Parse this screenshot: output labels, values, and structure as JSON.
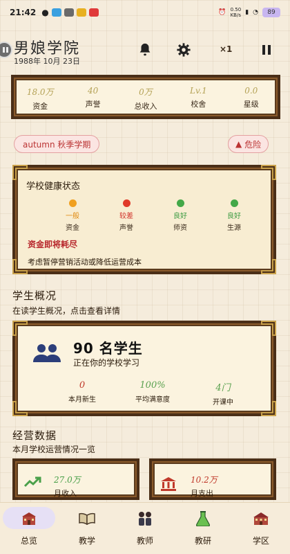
{
  "status_bar": {
    "time": "21:42",
    "net_speed": "0.50\nKB/s",
    "battery": "89"
  },
  "header": {
    "title": "男娘学院",
    "date": "1988年 10月 23日",
    "speed": "×1"
  },
  "stats": [
    {
      "value": "18.0万",
      "label": "资金"
    },
    {
      "value": "40",
      "label": "声誉"
    },
    {
      "value": "0万",
      "label": "总收入"
    },
    {
      "value": "Lv.1",
      "label": "校舍"
    },
    {
      "value": "0.0",
      "label": "星级"
    }
  ],
  "season_pill": "autumn 秋季学期",
  "danger_pill": "危险",
  "health": {
    "title": "学校健康状态",
    "indicators": [
      {
        "status": "一般",
        "name": "资金",
        "color": "#f0a020"
      },
      {
        "status": "较差",
        "name": "声誉",
        "color": "#e03a2a"
      },
      {
        "status": "良好",
        "name": "师资",
        "color": "#43a848"
      },
      {
        "status": "良好",
        "name": "生源",
        "color": "#43a848"
      }
    ],
    "warning": "资金即将耗尽",
    "advice": "考虑暂停营销活动或降低运营成本"
  },
  "students_section": {
    "title": "学生概况",
    "subtitle": "在读学生概况，点击查看详情",
    "count": "90 名学生",
    "count_sub": "正在你的学校学习",
    "stats": [
      {
        "value": "0",
        "label": "本月新生"
      },
      {
        "value": "100%",
        "label": "平均满意度"
      },
      {
        "value": "4门",
        "label": "开课中"
      }
    ]
  },
  "ops_section": {
    "title": "经营数据",
    "subtitle": "本月学校运营情况一览",
    "cards": [
      {
        "value": "27.0万",
        "label": "月收入",
        "color": "#4aa04a"
      },
      {
        "value": "10.2万",
        "label": "月支出",
        "color": "#c0392b"
      }
    ]
  },
  "nav": [
    {
      "label": "总览",
      "icon": "school-icon"
    },
    {
      "label": "教学",
      "icon": "book-icon"
    },
    {
      "label": "教师",
      "icon": "teachers-icon"
    },
    {
      "label": "教研",
      "icon": "flask-icon"
    },
    {
      "label": "学区",
      "icon": "district-icon"
    }
  ],
  "colors": {
    "frame": "#4a2e17",
    "accent_gold": "#b4a256",
    "danger": "#b7262b",
    "good": "#5aa14f"
  }
}
